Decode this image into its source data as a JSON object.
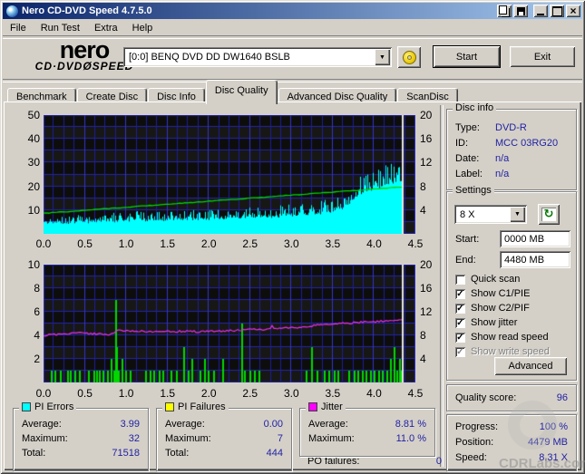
{
  "window": {
    "title": "Nero CD-DVD Speed 4.7.5.0"
  },
  "menu": {
    "items": [
      "File",
      "Run Test",
      "Extra",
      "Help"
    ]
  },
  "header": {
    "logo_line1": "nero",
    "logo_line2": "CD·DVDØSPEED",
    "drive_selected": "[0:0]  BENQ DVD DD DW1640 BSLB",
    "start_label": "Start",
    "exit_label": "Exit"
  },
  "tabs": {
    "items": [
      "Benchmark",
      "Create Disc",
      "Disc Info",
      "Disc Quality",
      "Advanced Disc Quality",
      "ScanDisc"
    ],
    "active": "Disc Quality"
  },
  "disc_info": {
    "title": "Disc info",
    "rows": [
      [
        "Type:",
        "DVD-R"
      ],
      [
        "ID:",
        "MCC 03RG20"
      ],
      [
        "Date:",
        "n/a"
      ],
      [
        "Label:",
        "n/a"
      ]
    ]
  },
  "settings": {
    "title": "Settings",
    "speed_value": "8 X",
    "start_label": "Start:",
    "start_value": "0000 MB",
    "end_label": "End:",
    "end_value": "4480 MB",
    "checkboxes": [
      {
        "label": "Quick scan",
        "checked": false,
        "disabled": false
      },
      {
        "label": "Show C1/PIE",
        "checked": true,
        "disabled": false
      },
      {
        "label": "Show C2/PIF",
        "checked": true,
        "disabled": false
      },
      {
        "label": "Show jitter",
        "checked": true,
        "disabled": false
      },
      {
        "label": "Show read speed",
        "checked": true,
        "disabled": false
      },
      {
        "label": "Show write speed",
        "checked": true,
        "disabled": true
      }
    ],
    "advanced_label": "Advanced"
  },
  "quality": {
    "label": "Quality score:",
    "value": "96"
  },
  "progress": {
    "rows": [
      [
        "Progress:",
        "100 %"
      ],
      [
        "Position:",
        "4479 MB"
      ],
      [
        "Speed:",
        "8.31 X"
      ]
    ]
  },
  "stats": [
    {
      "title": "PI Errors",
      "color": "#00FFFF",
      "rows": [
        [
          "Average:",
          "3.99"
        ],
        [
          "Maximum:",
          "32"
        ],
        [
          "Total:",
          "71518"
        ]
      ]
    },
    {
      "title": "PI Failures",
      "color": "#FFFF00",
      "rows": [
        [
          "Average:",
          "0.00"
        ],
        [
          "Maximum:",
          "7"
        ],
        [
          "Total:",
          "444"
        ]
      ]
    },
    {
      "title": "Jitter",
      "color": "#FF00FF",
      "rows": [
        [
          "Average:",
          "8.81 %"
        ],
        [
          "Maximum:",
          "11.0 %"
        ]
      ]
    }
  ],
  "po": {
    "label": "PO failures:",
    "value": "0"
  },
  "watermark": {
    "text": "CDRLabs.com"
  },
  "colors": {
    "value_text": "#2222a2",
    "chart_cyan": "#00ffff",
    "chart_green": "#00d800",
    "chart_magenta": "#e632e6",
    "grid_minor": "#1e1e9a",
    "grid_major": "#3434cc",
    "grid_h": "#2626aa",
    "band_dark": "#0d0d0c",
    "band_light": "#171715",
    "cursor": "#e6e6e6"
  },
  "chart_data": [
    {
      "type": "area",
      "title": "PI Errors with read speed overlay",
      "x_range": [
        0,
        4.5
      ],
      "x_ticks": [
        0,
        0.5,
        1,
        1.5,
        2,
        2.5,
        3,
        3.5,
        4,
        4.5
      ],
      "data_end_x": 4.35,
      "left_axis": {
        "range": [
          0,
          50
        ],
        "ticks": [
          50,
          40,
          30,
          20,
          10
        ]
      },
      "right_axis": {
        "range": [
          0,
          20
        ],
        "ticks": [
          20,
          16,
          12,
          8,
          4
        ]
      },
      "pi_errors_envelope": {
        "x_start": 0,
        "x_step": 0.05,
        "base": [
          5,
          4.5,
          4.5,
          5,
          4.5,
          4,
          4,
          4.5,
          4.5,
          5,
          5,
          4.5,
          5,
          5,
          5,
          5,
          5.5,
          5,
          5,
          5.5,
          5.5,
          5,
          5.5,
          5.5,
          5.5,
          5.5,
          5.5,
          5.5,
          6,
          5.5,
          5.5,
          6,
          6,
          6,
          6,
          6,
          6,
          6,
          6,
          6,
          6,
          6,
          6.5,
          6,
          6.5,
          6.5,
          6.5,
          6.5,
          6.5,
          6.5,
          7,
          7,
          7,
          7,
          7,
          7,
          7,
          7,
          7.5,
          7.5,
          7.5,
          7.5,
          8,
          8,
          8,
          8,
          8.5,
          8.5,
          9,
          9,
          9.5,
          10,
          10.5,
          11,
          12,
          14,
          16,
          17,
          18,
          18,
          19,
          19,
          20,
          21,
          21,
          21,
          22,
          22
        ],
        "peak": [
          8,
          8,
          7,
          8,
          7.5,
          7,
          8.5,
          7,
          8,
          9,
          8,
          7.5,
          8,
          9.5,
          8,
          8.5,
          9,
          10,
          8.5,
          9,
          9.5,
          8.5,
          9,
          10,
          9,
          9.5,
          9,
          10,
          9.5,
          9,
          9.5,
          10,
          9.5,
          10,
          10.5,
          9.5,
          10,
          10.5,
          10,
          10.5,
          10,
          10.5,
          10.5,
          10,
          11,
          10.5,
          11,
          10.5,
          11,
          11,
          11.5,
          11,
          11.5,
          11,
          11.5,
          12,
          11.5,
          12,
          12,
          12.5,
          12,
          12.5,
          13,
          12.5,
          13,
          13.5,
          13.5,
          14,
          14.5,
          15,
          15,
          16,
          17,
          18,
          19,
          22,
          24,
          26,
          26,
          27,
          28,
          27,
          29,
          31,
          32,
          30,
          29,
          25
        ]
      },
      "read_speed_line": {
        "axis": "right",
        "start": [
          0,
          3.45
        ],
        "end": [
          4.35,
          7.9
        ]
      }
    },
    {
      "type": "bar",
      "title": "PI Failures with jitter overlay",
      "x_range": [
        0,
        4.5
      ],
      "x_ticks": [
        0,
        0.5,
        1,
        1.5,
        2,
        2.5,
        3,
        3.5,
        4,
        4.5
      ],
      "data_end_x": 4.35,
      "left_axis": {
        "range": [
          0,
          10
        ],
        "ticks": [
          10,
          8,
          6,
          4,
          2
        ]
      },
      "right_axis": {
        "range": [
          0,
          20
        ],
        "ticks": [
          20,
          16,
          12,
          8,
          4
        ]
      },
      "pi_failure_bars": [
        [
          0.1,
          1
        ],
        [
          0.14,
          1
        ],
        [
          0.21,
          1
        ],
        [
          0.3,
          1
        ],
        [
          0.33,
          1
        ],
        [
          0.38,
          1
        ],
        [
          0.44,
          1
        ],
        [
          0.55,
          1
        ],
        [
          0.61,
          1
        ],
        [
          0.65,
          1
        ],
        [
          0.68,
          1
        ],
        [
          0.72,
          1
        ],
        [
          0.78,
          1
        ],
        [
          0.82,
          2
        ],
        [
          0.86,
          1
        ],
        [
          0.875,
          7
        ],
        [
          0.885,
          3
        ],
        [
          0.895,
          1
        ],
        [
          0.91,
          1
        ],
        [
          0.95,
          2
        ],
        [
          1.0,
          1
        ],
        [
          1.05,
          1
        ],
        [
          1.24,
          1
        ],
        [
          1.3,
          1
        ],
        [
          1.34,
          1
        ],
        [
          1.4,
          1
        ],
        [
          1.45,
          1
        ],
        [
          1.55,
          1
        ],
        [
          1.61,
          1
        ],
        [
          1.7,
          3
        ],
        [
          1.76,
          1
        ],
        [
          1.8,
          2
        ],
        [
          1.9,
          1
        ],
        [
          1.95,
          2
        ],
        [
          2.0,
          1
        ],
        [
          2.06,
          1
        ],
        [
          2.17,
          2
        ],
        [
          2.4,
          5
        ],
        [
          2.44,
          1
        ],
        [
          2.5,
          1
        ],
        [
          2.56,
          1
        ],
        [
          2.61,
          1
        ],
        [
          3.18,
          1
        ],
        [
          3.25,
          3
        ],
        [
          3.31,
          1
        ],
        [
          3.4,
          1
        ],
        [
          3.46,
          1
        ],
        [
          3.52,
          1
        ],
        [
          3.57,
          1
        ],
        [
          3.7,
          1
        ],
        [
          3.76,
          1
        ],
        [
          3.81,
          1
        ],
        [
          3.86,
          1
        ],
        [
          3.91,
          1
        ],
        [
          3.96,
          1
        ],
        [
          4.01,
          1
        ],
        [
          4.06,
          1
        ],
        [
          4.11,
          1
        ],
        [
          4.16,
          1
        ],
        [
          4.2,
          2
        ],
        [
          4.25,
          3
        ],
        [
          4.28,
          1
        ],
        [
          4.31,
          2
        ],
        [
          4.33,
          1
        ],
        [
          4.35,
          1
        ]
      ],
      "jitter_line": {
        "axis": "left",
        "points": [
          [
            0,
            4.0
          ],
          [
            0.2,
            4.1
          ],
          [
            0.4,
            4.2
          ],
          [
            0.6,
            4.15
          ],
          [
            0.8,
            4.05
          ],
          [
            0.9,
            4.45
          ],
          [
            1.1,
            4.35
          ],
          [
            1.3,
            4.3
          ],
          [
            1.5,
            4.3
          ],
          [
            1.7,
            4.35
          ],
          [
            1.9,
            4.3
          ],
          [
            2.1,
            4.35
          ],
          [
            2.3,
            4.4
          ],
          [
            2.5,
            4.5
          ],
          [
            2.7,
            4.5
          ],
          [
            2.9,
            4.6
          ],
          [
            3.1,
            4.65
          ],
          [
            3.3,
            4.85
          ],
          [
            3.5,
            5.0
          ],
          [
            3.7,
            5.05
          ],
          [
            3.9,
            5.15
          ],
          [
            4.1,
            5.2
          ],
          [
            4.25,
            5.25
          ],
          [
            4.35,
            5.3
          ]
        ]
      }
    }
  ]
}
